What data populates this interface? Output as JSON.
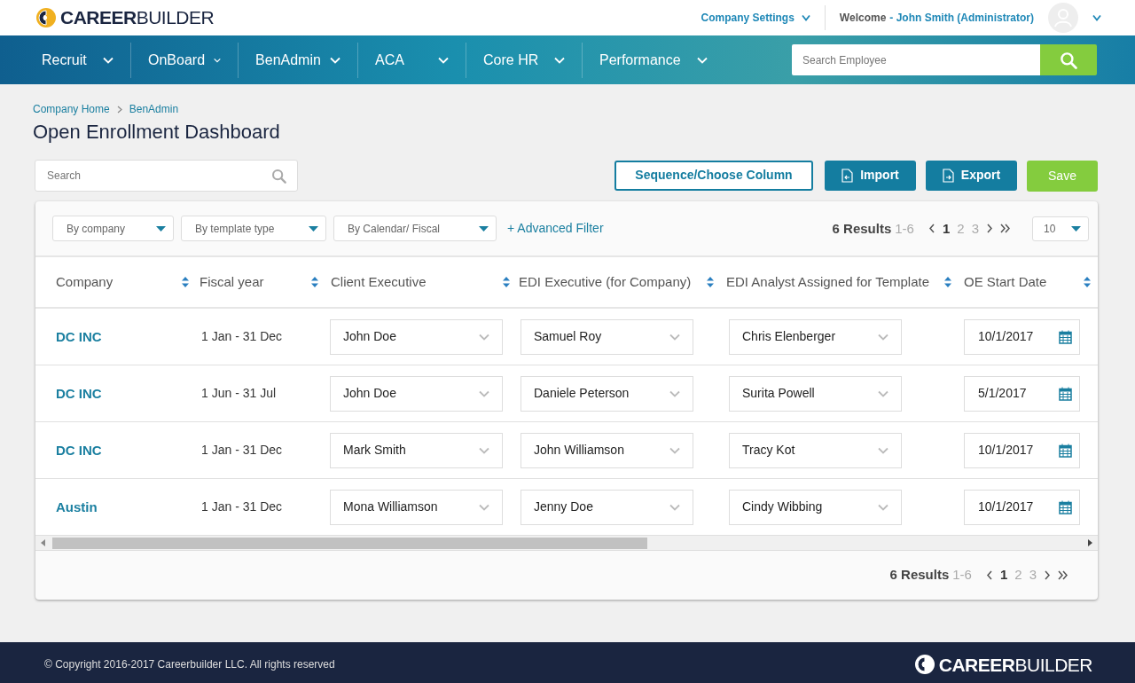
{
  "logo": "**CAREER**BUILDER",
  "top_bar": {
    "company_settings": "Company Settings",
    "welcome": "Welcome",
    "user": "- John Smith (Administrator)"
  },
  "nav": [
    {
      "label": "Recruit"
    },
    {
      "label": "OnBoard"
    },
    {
      "label": "BenAdmin"
    },
    {
      "label": "ACA"
    },
    {
      "label": "Core HR"
    },
    {
      "label": "Performance"
    }
  ],
  "employee_search": {
    "placeholder": "Search Employee"
  },
  "breadcrumb": [
    "Company Home",
    "BenAdmin"
  ],
  "title": "Open Enrollment Dashboard",
  "search": {
    "placeholder": "Search"
  },
  "buttons": [
    {
      "label": "Sequence/Choose Column",
      "kind": "outline"
    },
    {
      "label": "Import",
      "kind": "import"
    },
    {
      "label": "Export",
      "kind": "export"
    },
    {
      "label": "Save",
      "kind": "save"
    }
  ],
  "filters": [
    "By company",
    "By template type",
    "By Calendar/ Fiscal"
  ],
  "advanced_filter": "+ Advanced Filter",
  "pagination_top": {
    "results": "6 Results",
    "range": "1-6",
    "pages": [
      {
        "label": "1",
        "selected": true
      },
      {
        "label": "2",
        "selected": false
      },
      {
        "label": "3",
        "selected": false
      }
    ]
  },
  "page_size": "10",
  "table": {
    "columns": [
      "Company",
      "Fiscal year",
      "Client Executive",
      "EDI Executive (for Company)",
      "EDI Analyst Assigned for Template",
      "OE Start Date"
    ],
    "rows": [
      {
        "company": "DC INC",
        "fiscal_year": "1 Jan - 31 Dec",
        "client_executive": "John Doe",
        "edi_executive": "Samuel Roy",
        "edi_analyst": "Chris Elenberger",
        "oe_start_date": "10/1/2017"
      },
      {
        "company": "DC INC",
        "fiscal_year": "1 Jun - 31 Jul",
        "client_executive": "John Doe",
        "edi_executive": "Daniele Peterson",
        "edi_analyst": "Surita Powell",
        "oe_start_date": "5/1/2017"
      },
      {
        "company": "DC INC",
        "fiscal_year": "1 Jan - 31 Dec",
        "client_executive": "Mark Smith",
        "edi_executive": "John Williamson",
        "edi_analyst": "Tracy Kot",
        "oe_start_date": "10/1/2017"
      },
      {
        "company": "Austin",
        "fiscal_year": "1 Jan - 31 Dec",
        "client_executive": "Mona Williamson",
        "edi_executive": "Jenny Doe",
        "edi_analyst": "Cindy Wibbing",
        "oe_start_date": "10/1/2017"
      }
    ]
  },
  "pagination_bottom": {
    "results": "6 Results",
    "range": "1-6",
    "pages": [
      {
        "label": "1",
        "selected": true
      },
      {
        "label": "2",
        "selected": false
      },
      {
        "label": "3",
        "selected": false
      }
    ]
  },
  "footer": {
    "copyright": "© Copyright 2016-2017 Careerbuilder LLC. All rights reserved",
    "logo": "**CAREER**BUILDER"
  }
}
